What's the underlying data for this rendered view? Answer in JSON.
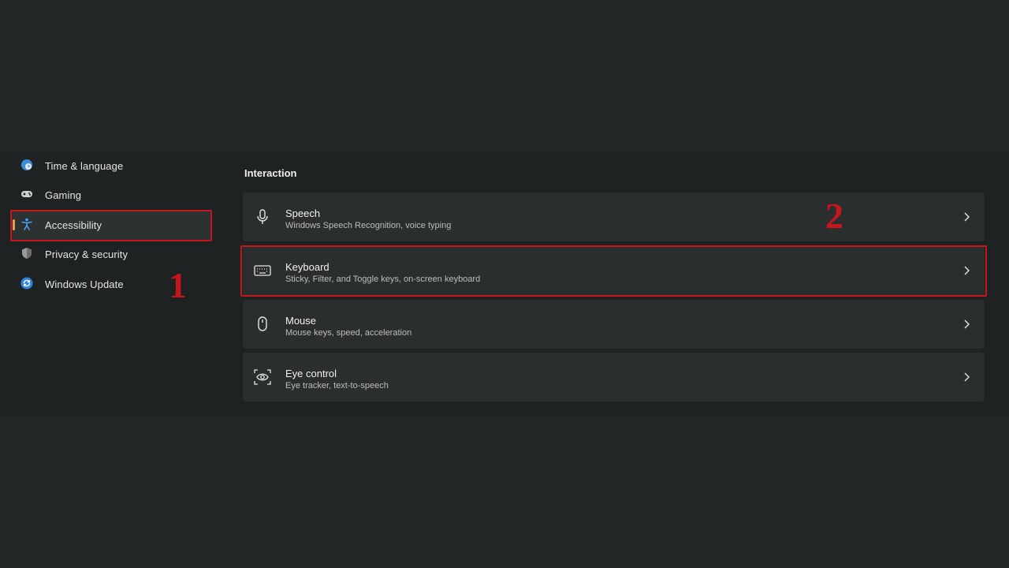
{
  "sidebar": {
    "items": [
      {
        "label": "Time & language",
        "icon": "globe-clock-icon",
        "selected": false
      },
      {
        "label": "Gaming",
        "icon": "gamepad-icon",
        "selected": false
      },
      {
        "label": "Accessibility",
        "icon": "accessibility-icon",
        "selected": true
      },
      {
        "label": "Privacy & security",
        "icon": "shield-icon",
        "selected": false
      },
      {
        "label": "Windows Update",
        "icon": "update-icon",
        "selected": false
      }
    ]
  },
  "annotations": {
    "marker_1": "1",
    "marker_2": "2",
    "color": "#c8161d"
  },
  "main": {
    "section_title": "Interaction",
    "cards": [
      {
        "title": "Speech",
        "description": "Windows Speech Recognition, voice typing",
        "icon": "microphone-icon"
      },
      {
        "title": "Keyboard",
        "description": "Sticky, Filter, and Toggle keys, on-screen keyboard",
        "icon": "keyboard-icon"
      },
      {
        "title": "Mouse",
        "description": "Mouse keys, speed, acceleration",
        "icon": "mouse-icon"
      },
      {
        "title": "Eye control",
        "description": "Eye tracker, text-to-speech",
        "icon": "eye-control-icon"
      }
    ]
  },
  "colors": {
    "accent": "#e0a14e",
    "background": "#222828",
    "card": "#2a2e2e"
  }
}
